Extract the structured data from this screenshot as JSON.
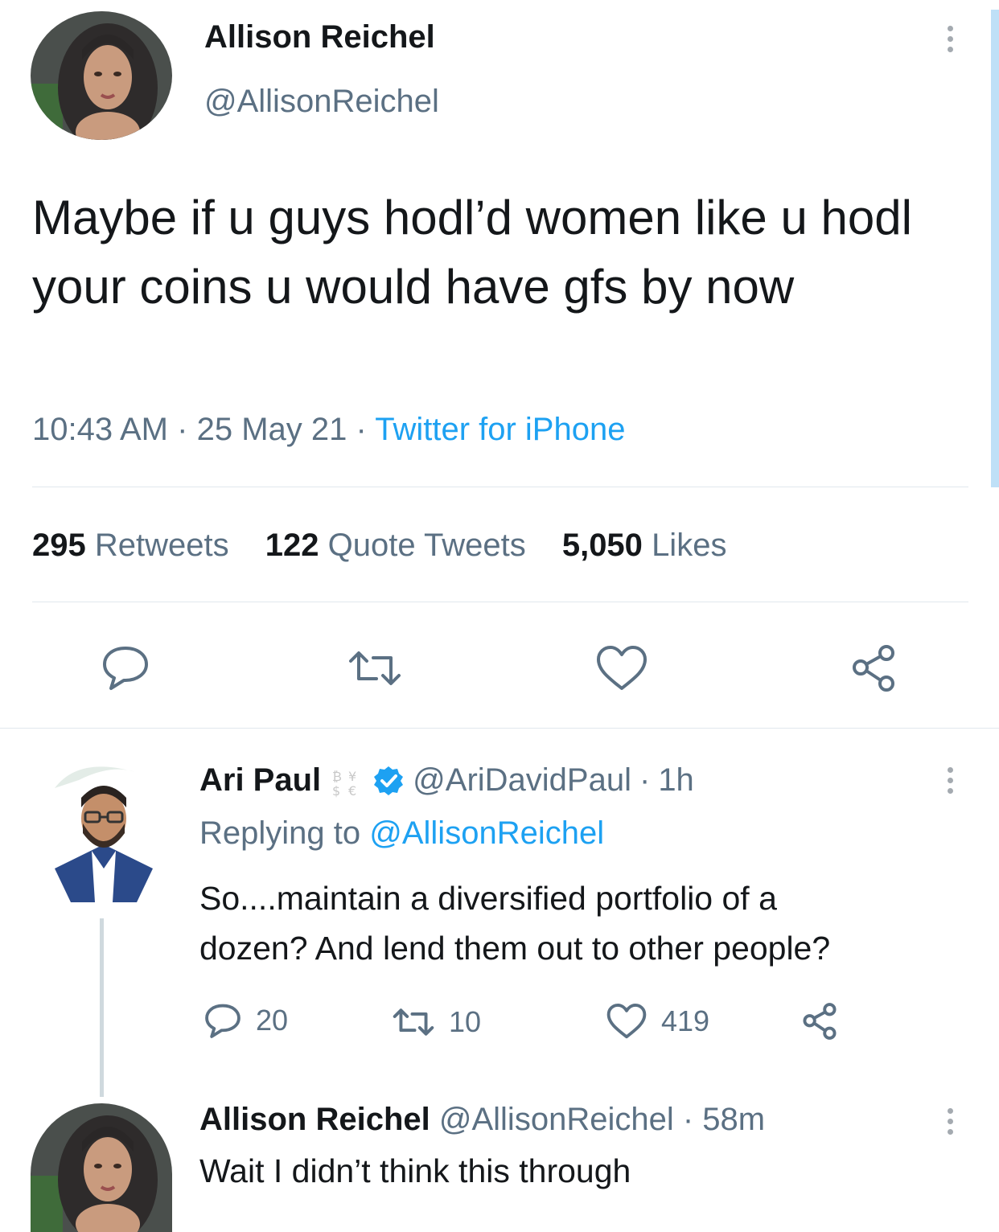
{
  "main_tweet": {
    "author_name": "Allison Reichel",
    "handle": "@AllisonReichel",
    "text": "Maybe if u guys hodl’d women like u hodl your coins u would have gfs by now",
    "time": "10:43 AM",
    "sep1": "·",
    "date": "25 May 21",
    "sep2": "·",
    "source": "Twitter for iPhone",
    "stats": {
      "retweets_count": "295",
      "retweets_label": "Retweets",
      "quotes_count": "122",
      "quotes_label": "Quote Tweets",
      "likes_count": "5,050",
      "likes_label": "Likes"
    },
    "icons": [
      "reply-icon",
      "retweet-icon",
      "like-icon",
      "share-icon",
      "more-icon"
    ]
  },
  "reply_1": {
    "author_name": "Ari Paul",
    "handle": "@AriDavidPaul",
    "sep": "·",
    "time": "1h",
    "replying_label": "Replying to",
    "replying_handle": "@AllisonReichel",
    "text_line1": "So....maintain a diversified portfolio of a",
    "text_line2": "dozen?  And lend them out to other people?",
    "reply_count": "20",
    "retweet_count": "10",
    "like_count": "419",
    "icons": [
      "emoji-icon",
      "verified-badge-icon",
      "reply-icon",
      "retweet-icon",
      "like-icon",
      "share-icon",
      "more-icon"
    ]
  },
  "reply_2": {
    "author_name": "Allison Reichel",
    "handle": "@AllisonReichel",
    "sep": "·",
    "time": "58m",
    "text": "Wait I didn’t think this through",
    "icons": [
      "more-icon"
    ]
  },
  "colors": {
    "text": "#14171a",
    "muted": "#5b7083",
    "link": "#1da1f2",
    "divider": "#e1e8ed",
    "verified": "#1da1f2"
  }
}
